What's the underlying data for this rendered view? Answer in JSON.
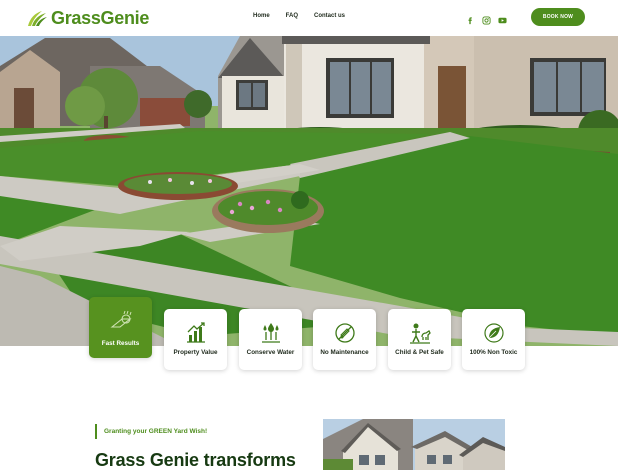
{
  "brand": {
    "name": "GrassGenie",
    "name_part1": "Grass",
    "name_part2": "Genie",
    "color": "#4e8d1d"
  },
  "nav": {
    "links": [
      {
        "label": "Home"
      },
      {
        "label": "FAQ"
      },
      {
        "label": "Contact us"
      }
    ],
    "social": [
      "facebook-icon",
      "instagram-icon",
      "youtube-icon"
    ],
    "cta": "BOOK NOW"
  },
  "features": [
    {
      "label": "Fast Results",
      "icon": "turf-roll-icon",
      "highlighted": true
    },
    {
      "label": "Property Value",
      "icon": "growth-chart-icon",
      "highlighted": false
    },
    {
      "label": "Conserve Water",
      "icon": "water-drops-icon",
      "highlighted": false
    },
    {
      "label": "No Maintenance",
      "icon": "no-mower-icon",
      "highlighted": false
    },
    {
      "label": "Child & Pet Safe",
      "icon": "child-pet-icon",
      "highlighted": false
    },
    {
      "label": "100% Non Toxic",
      "icon": "eco-leaf-icon",
      "highlighted": false
    }
  ],
  "intro": {
    "tagline": "Granting your GREEN Yard Wish!",
    "headline": "Grass Genie transforms"
  },
  "colors": {
    "accent": "#4e8d1d",
    "card_primary": "#57921f",
    "text_dark": "#173a12"
  }
}
